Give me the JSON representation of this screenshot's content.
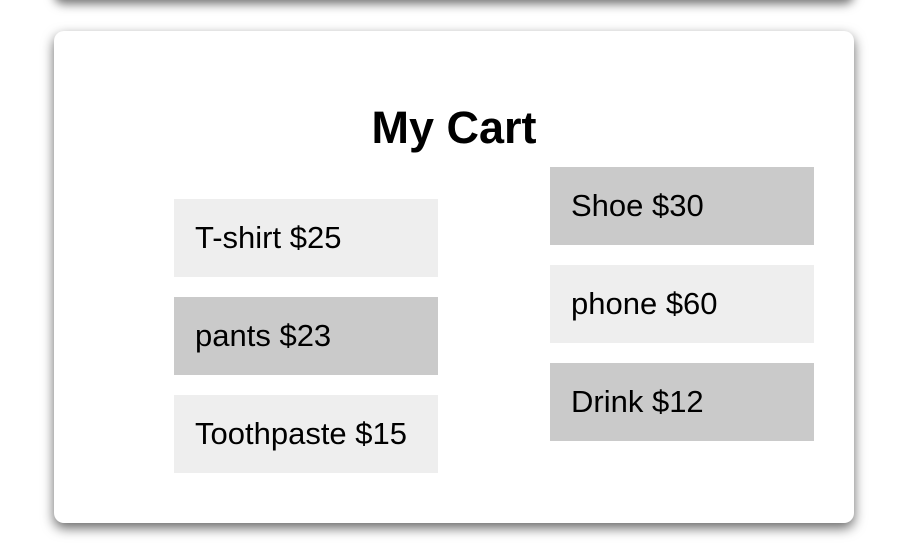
{
  "cart": {
    "title": "My Cart",
    "left_column": [
      {
        "label": "T-shirt $25",
        "shade": "#eeeeee"
      },
      {
        "label": "pants $23",
        "shade": "#cacaca"
      },
      {
        "label": "Toothpaste $15",
        "shade": "#eeeeee"
      }
    ],
    "right_column": [
      {
        "label": "Shoe $30",
        "shade": "#cacaca"
      },
      {
        "label": "phone $60",
        "shade": "#eeeeee"
      },
      {
        "label": "Drink $12",
        "shade": "#cacaca"
      }
    ]
  }
}
